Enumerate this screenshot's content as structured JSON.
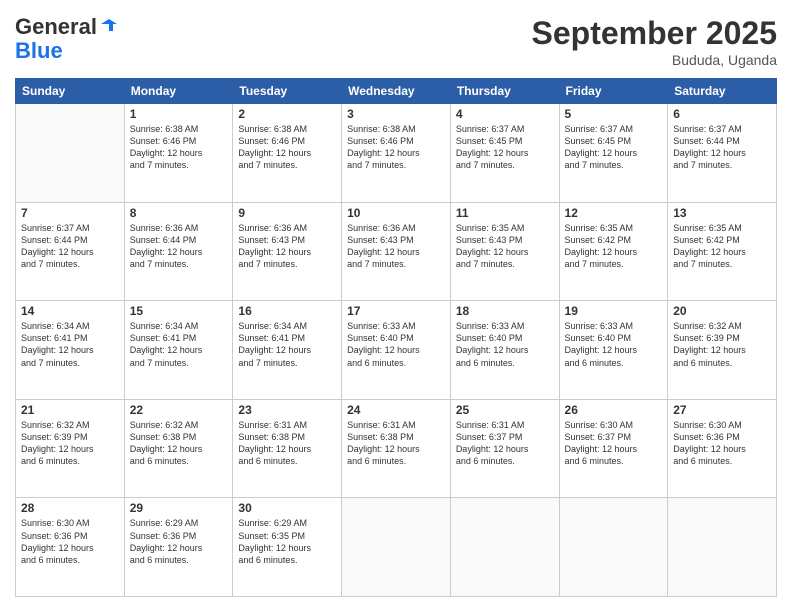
{
  "header": {
    "logo_line1": "General",
    "logo_line2": "Blue",
    "month": "September 2025",
    "location": "Bududa, Uganda"
  },
  "weekdays": [
    "Sunday",
    "Monday",
    "Tuesday",
    "Wednesday",
    "Thursday",
    "Friday",
    "Saturday"
  ],
  "weeks": [
    [
      {
        "day": "",
        "text": ""
      },
      {
        "day": "1",
        "text": "Sunrise: 6:38 AM\nSunset: 6:46 PM\nDaylight: 12 hours\nand 7 minutes."
      },
      {
        "day": "2",
        "text": "Sunrise: 6:38 AM\nSunset: 6:46 PM\nDaylight: 12 hours\nand 7 minutes."
      },
      {
        "day": "3",
        "text": "Sunrise: 6:38 AM\nSunset: 6:46 PM\nDaylight: 12 hours\nand 7 minutes."
      },
      {
        "day": "4",
        "text": "Sunrise: 6:37 AM\nSunset: 6:45 PM\nDaylight: 12 hours\nand 7 minutes."
      },
      {
        "day": "5",
        "text": "Sunrise: 6:37 AM\nSunset: 6:45 PM\nDaylight: 12 hours\nand 7 minutes."
      },
      {
        "day": "6",
        "text": "Sunrise: 6:37 AM\nSunset: 6:44 PM\nDaylight: 12 hours\nand 7 minutes."
      }
    ],
    [
      {
        "day": "7",
        "text": "Sunrise: 6:37 AM\nSunset: 6:44 PM\nDaylight: 12 hours\nand 7 minutes."
      },
      {
        "day": "8",
        "text": "Sunrise: 6:36 AM\nSunset: 6:44 PM\nDaylight: 12 hours\nand 7 minutes."
      },
      {
        "day": "9",
        "text": "Sunrise: 6:36 AM\nSunset: 6:43 PM\nDaylight: 12 hours\nand 7 minutes."
      },
      {
        "day": "10",
        "text": "Sunrise: 6:36 AM\nSunset: 6:43 PM\nDaylight: 12 hours\nand 7 minutes."
      },
      {
        "day": "11",
        "text": "Sunrise: 6:35 AM\nSunset: 6:43 PM\nDaylight: 12 hours\nand 7 minutes."
      },
      {
        "day": "12",
        "text": "Sunrise: 6:35 AM\nSunset: 6:42 PM\nDaylight: 12 hours\nand 7 minutes."
      },
      {
        "day": "13",
        "text": "Sunrise: 6:35 AM\nSunset: 6:42 PM\nDaylight: 12 hours\nand 7 minutes."
      }
    ],
    [
      {
        "day": "14",
        "text": "Sunrise: 6:34 AM\nSunset: 6:41 PM\nDaylight: 12 hours\nand 7 minutes."
      },
      {
        "day": "15",
        "text": "Sunrise: 6:34 AM\nSunset: 6:41 PM\nDaylight: 12 hours\nand 7 minutes."
      },
      {
        "day": "16",
        "text": "Sunrise: 6:34 AM\nSunset: 6:41 PM\nDaylight: 12 hours\nand 7 minutes."
      },
      {
        "day": "17",
        "text": "Sunrise: 6:33 AM\nSunset: 6:40 PM\nDaylight: 12 hours\nand 6 minutes."
      },
      {
        "day": "18",
        "text": "Sunrise: 6:33 AM\nSunset: 6:40 PM\nDaylight: 12 hours\nand 6 minutes."
      },
      {
        "day": "19",
        "text": "Sunrise: 6:33 AM\nSunset: 6:40 PM\nDaylight: 12 hours\nand 6 minutes."
      },
      {
        "day": "20",
        "text": "Sunrise: 6:32 AM\nSunset: 6:39 PM\nDaylight: 12 hours\nand 6 minutes."
      }
    ],
    [
      {
        "day": "21",
        "text": "Sunrise: 6:32 AM\nSunset: 6:39 PM\nDaylight: 12 hours\nand 6 minutes."
      },
      {
        "day": "22",
        "text": "Sunrise: 6:32 AM\nSunset: 6:38 PM\nDaylight: 12 hours\nand 6 minutes."
      },
      {
        "day": "23",
        "text": "Sunrise: 6:31 AM\nSunset: 6:38 PM\nDaylight: 12 hours\nand 6 minutes."
      },
      {
        "day": "24",
        "text": "Sunrise: 6:31 AM\nSunset: 6:38 PM\nDaylight: 12 hours\nand 6 minutes."
      },
      {
        "day": "25",
        "text": "Sunrise: 6:31 AM\nSunset: 6:37 PM\nDaylight: 12 hours\nand 6 minutes."
      },
      {
        "day": "26",
        "text": "Sunrise: 6:30 AM\nSunset: 6:37 PM\nDaylight: 12 hours\nand 6 minutes."
      },
      {
        "day": "27",
        "text": "Sunrise: 6:30 AM\nSunset: 6:36 PM\nDaylight: 12 hours\nand 6 minutes."
      }
    ],
    [
      {
        "day": "28",
        "text": "Sunrise: 6:30 AM\nSunset: 6:36 PM\nDaylight: 12 hours\nand 6 minutes."
      },
      {
        "day": "29",
        "text": "Sunrise: 6:29 AM\nSunset: 6:36 PM\nDaylight: 12 hours\nand 6 minutes."
      },
      {
        "day": "30",
        "text": "Sunrise: 6:29 AM\nSunset: 6:35 PM\nDaylight: 12 hours\nand 6 minutes."
      },
      {
        "day": "",
        "text": ""
      },
      {
        "day": "",
        "text": ""
      },
      {
        "day": "",
        "text": ""
      },
      {
        "day": "",
        "text": ""
      }
    ]
  ]
}
